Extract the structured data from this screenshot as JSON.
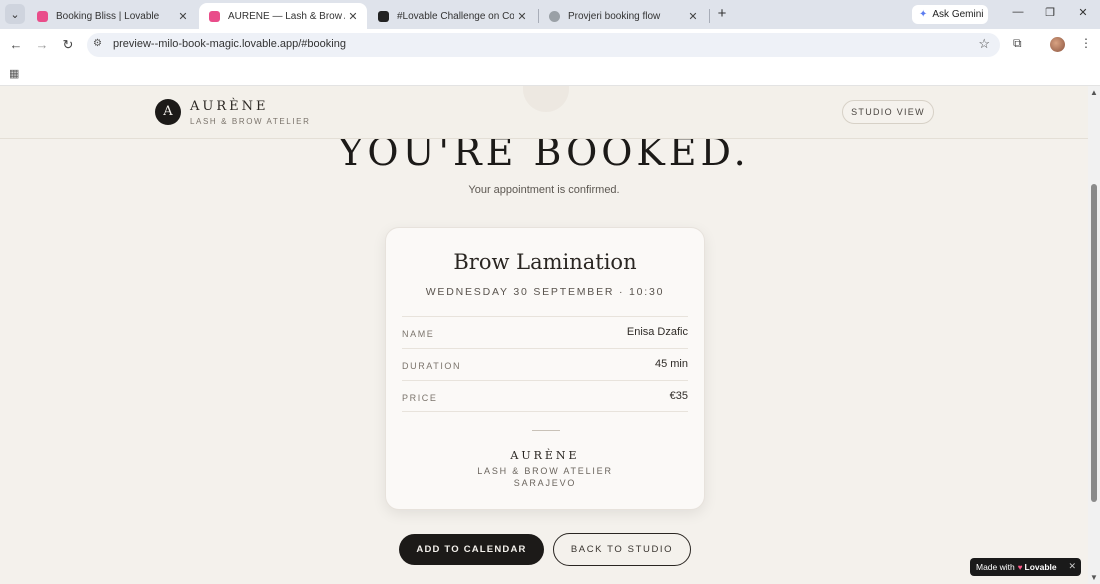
{
  "browser": {
    "tabs": [
      {
        "title": "Booking Bliss | Lovable",
        "favicon_color": "#e94d8a"
      },
      {
        "title": "AURÈNE — Lash & Brow Atelier",
        "favicon_color": "#e94d8a"
      },
      {
        "title": "#Lovable Challenge on Contra",
        "favicon_color": "#222222"
      },
      {
        "title": "Provjeri booking flow",
        "favicon_color": "#9aa0a6"
      }
    ],
    "ask_gemini": "Ask Gemini",
    "url": "preview--milo-book-magic.lovable.app/#booking"
  },
  "header": {
    "logo_letter": "A",
    "brand_name": "AURÈNE",
    "brand_tagline": "LASH & BROW ATELIER",
    "studio_view_label": "STUDIO VIEW"
  },
  "confirmation": {
    "headline": "YOU'RE BOOKED.",
    "subline": "Your appointment is confirmed."
  },
  "card": {
    "service": "Brow Lamination",
    "when": "WEDNESDAY 30 SEPTEMBER · 10:30",
    "rows": [
      {
        "label": "NAME",
        "value": "Enisa Dzafic"
      },
      {
        "label": "DURATION",
        "value": "45 min"
      },
      {
        "label": "PRICE",
        "value": "€35"
      }
    ],
    "brand": "AURÈNE",
    "tagline": "LASH & BROW ATELIER",
    "city": "SARAJEVO"
  },
  "actions": {
    "add_to_calendar": "ADD TO CALENDAR",
    "back_to_studio": "BACK TO STUDIO"
  },
  "badge": {
    "made_with": "Made with",
    "brand": "Lovable"
  }
}
